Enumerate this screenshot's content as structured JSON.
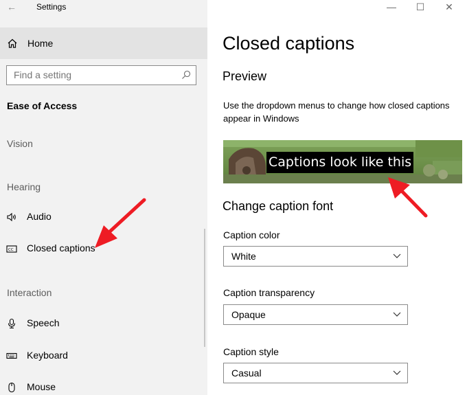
{
  "window": {
    "app_title": "Settings",
    "controls": [
      "minimize-icon",
      "maximize-icon",
      "close-icon"
    ]
  },
  "sidebar": {
    "home_label": "Home",
    "search": {
      "placeholder": "Find a setting"
    },
    "section_title": "Ease of Access",
    "groups": {
      "vision": "Vision",
      "hearing": "Hearing",
      "interaction": "Interaction"
    },
    "items": [
      {
        "label": "Audio",
        "icon": "speaker-icon"
      },
      {
        "label": "Closed captions",
        "icon": "closed-captions-icon"
      },
      {
        "label": "Speech",
        "icon": "microphone-icon"
      },
      {
        "label": "Keyboard",
        "icon": "keyboard-icon"
      },
      {
        "label": "Mouse",
        "icon": "mouse-icon"
      }
    ]
  },
  "main": {
    "title": "Closed captions",
    "preview": {
      "heading": "Preview",
      "description": "Use the dropdown menus to change how closed captions appear in Windows",
      "caption_text": "Captions look like this"
    },
    "font_section": {
      "heading": "Change caption font",
      "fields": [
        {
          "label": "Caption color",
          "value": "White"
        },
        {
          "label": "Caption transparency",
          "value": "Opaque"
        },
        {
          "label": "Caption style",
          "value": "Casual"
        }
      ]
    }
  },
  "colors": {
    "sidebar_bg": "#f2f2f2",
    "selected_bg": "#e3e3e3",
    "annotation_arrow": "#ee1c24"
  }
}
